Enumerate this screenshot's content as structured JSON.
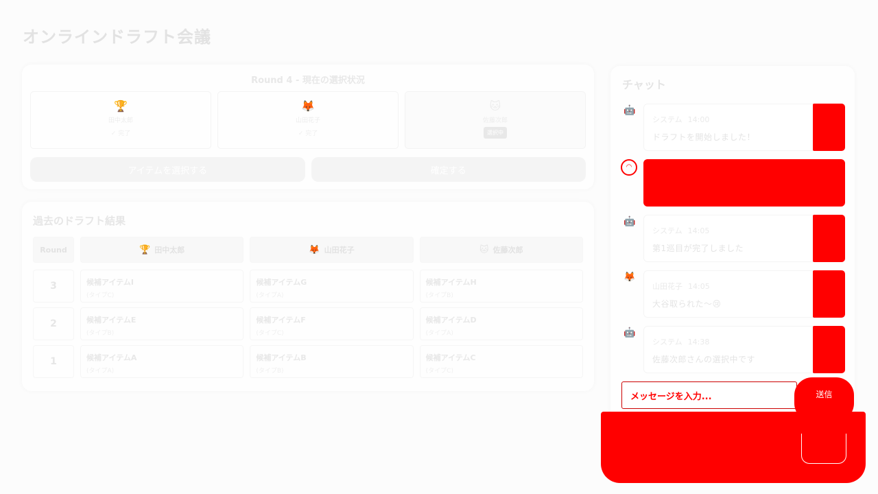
{
  "app": {
    "title": "オンラインドラフト会議"
  },
  "current_round": {
    "title": "Round 4 - 現在の選択状況",
    "players": [
      {
        "name": "田中太郎",
        "icon": "trophy-icon",
        "status": "✓ 完了"
      },
      {
        "name": "山田花子",
        "icon": "fox-icon",
        "status": "✓ 完了"
      },
      {
        "name": "佐藤次郎",
        "icon": "cat-icon",
        "status": "選択中"
      }
    ],
    "select_item_label": "アイテムを選択する",
    "confirm_label": "確定する"
  },
  "history": {
    "title": "過去のドラフト結果",
    "round_header": "Round",
    "players": [
      {
        "name": "田中太郎",
        "icon": "trophy-icon"
      },
      {
        "name": "山田花子",
        "icon": "fox-icon"
      },
      {
        "name": "佐藤次郎",
        "icon": "cat-icon"
      }
    ],
    "rows": [
      {
        "round": "3",
        "picks": [
          {
            "item": "候補アイテムI",
            "type": "(タイプC)"
          },
          {
            "item": "候補アイテムG",
            "type": "(タイプA)"
          },
          {
            "item": "候補アイテムH",
            "type": "(タイプB)"
          }
        ]
      },
      {
        "round": "2",
        "picks": [
          {
            "item": "候補アイテムE",
            "type": "(タイプB)"
          },
          {
            "item": "候補アイテムF",
            "type": "(タイプC)"
          },
          {
            "item": "候補アイテムD",
            "type": "(タイプA)"
          }
        ]
      },
      {
        "round": "1",
        "picks": [
          {
            "item": "候補アイテムA",
            "type": "(タイプA)"
          },
          {
            "item": "候補アイテムB",
            "type": "(タイプB)"
          },
          {
            "item": "候補アイテムC",
            "type": "(タイプC)"
          }
        ]
      }
    ]
  },
  "chat": {
    "title": "チャット",
    "messages": [
      {
        "sender": "システム",
        "time": "14:00",
        "text": "ドラフトを開始しました！",
        "icon": "robot-icon"
      },
      {
        "sender": "",
        "time": "",
        "text": "",
        "icon": "headset-icon"
      },
      {
        "sender": "システム",
        "time": "14:05",
        "text": "第1巡目が完了しました",
        "icon": "robot-icon"
      },
      {
        "sender": "山田花子",
        "time": "14:05",
        "text": "大谷取られた〜😢",
        "icon": "fox-icon"
      },
      {
        "sender": "システム",
        "time": "14:38",
        "text": "佐藤次郎さんの選択中です",
        "icon": "robot-icon"
      }
    ],
    "input_placeholder": "メッセージを入力...",
    "send_label": "送信"
  },
  "colors": {
    "overlay": "#ff0000",
    "text_faded": "#e6e6e6"
  }
}
